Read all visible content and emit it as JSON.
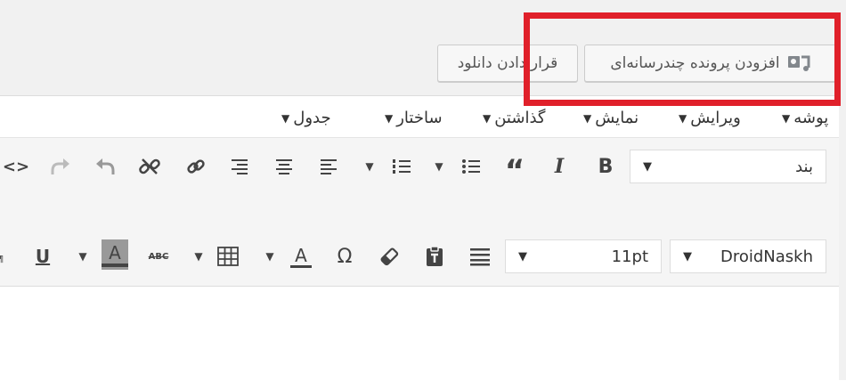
{
  "media_buttons": {
    "add_media": "افزودن پرونده چندرسانه‌ای",
    "add_download": "قرار دادن دانلود"
  },
  "menubar": {
    "items": [
      {
        "label": "پوشه"
      },
      {
        "label": "ویرایش"
      },
      {
        "label": "نمایش"
      },
      {
        "label": "گذاشتن"
      },
      {
        "label": "ساختار"
      },
      {
        "label": "جدول"
      }
    ]
  },
  "toolbar1": {
    "format_select": "بند",
    "buttons": [
      "bold",
      "italic",
      "blockquote",
      "bulleted-list",
      "numbered-list",
      "align-left",
      "align-center",
      "align-right",
      "link",
      "unlink",
      "undo",
      "redo",
      "code"
    ]
  },
  "toolbar2": {
    "font_family": "DroidNaskh",
    "font_size": "11pt",
    "buttons": [
      "justify",
      "paste-as-text",
      "clear-formatting",
      "special-character",
      "text-color",
      "table",
      "strikethrough",
      "background-color",
      "underline"
    ]
  },
  "icons": {
    "add_media": "media-icon",
    "caret": "▼"
  },
  "colors": {
    "highlight": "#e0202a",
    "button_bg": "#f7f7f7",
    "toolbar_bg": "#f5f5f5"
  }
}
